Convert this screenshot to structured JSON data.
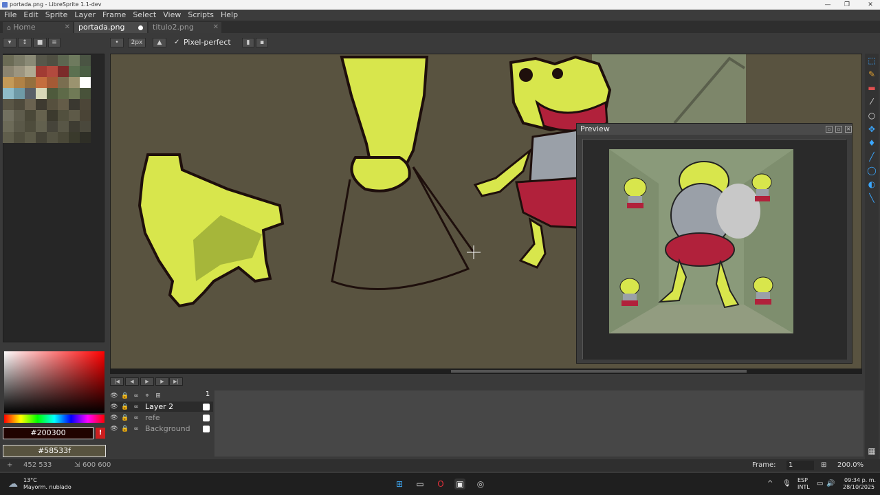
{
  "window": {
    "title": "portada.png - LibreSprite 1.1-dev"
  },
  "menu": [
    "File",
    "Edit",
    "Sprite",
    "Layer",
    "Frame",
    "Select",
    "View",
    "Scripts",
    "Help"
  ],
  "tabs": [
    {
      "label": "Home",
      "icon": "home-icon"
    },
    {
      "label": "portada.png"
    },
    {
      "label": "titulo2.png"
    }
  ],
  "tool_options": {
    "brush_size": "2px",
    "pixel_perfect_label": "Pixel-perfect",
    "pixel_perfect": true
  },
  "palette": [
    "#6b6b55",
    "#7a7a66",
    "#8a8a76",
    "#57574a",
    "#4f4f42",
    "#5c6650",
    "#6e7a5e",
    "#4a5443",
    "#8b8470",
    "#9c9580",
    "#b0aa92",
    "#a13b33",
    "#b24a3e",
    "#7b2b2a",
    "#5b7050",
    "#4a5e44",
    "#c49a58",
    "#b08246",
    "#95703e",
    "#c46e3e",
    "#a45a35",
    "#7a6e50",
    "#9b936f",
    "#ffffff",
    "#8fbcc8",
    "#6f9aa6",
    "#5a6068",
    "#d8d8b8",
    "#4e5a3c",
    "#5e6a48",
    "#707a56",
    "#48523a",
    "#5a5646",
    "#4e4a3c",
    "#6a6250",
    "#3e3a30",
    "#56503e",
    "#645c48",
    "#3a3830",
    "#4c4638",
    "#727060",
    "#5e5c4c",
    "#4a4838",
    "#66624e",
    "#3c3a2e",
    "#52503e",
    "#5e5a48",
    "#4a4436",
    "#6c6a58",
    "#5a5848",
    "#4e4c3c",
    "#62604e",
    "#46443a",
    "#585646",
    "#3e3c32",
    "#4a483c",
    "#605e4c",
    "#504e3e",
    "#5c5a48",
    "#444236",
    "#545242",
    "#4a4838",
    "#3a3a2c",
    "#2e2e26"
  ],
  "colors": {
    "foreground": "#200300",
    "background": "#58533f"
  },
  "preview": {
    "title": "Preview"
  },
  "layers": [
    {
      "name": "Layer 2",
      "active": true
    },
    {
      "name": "refe",
      "active": false
    },
    {
      "name": "Background",
      "active": false
    }
  ],
  "timeline": {
    "frame_header": "1"
  },
  "status": {
    "cursor": "452 533",
    "size": "600 600",
    "frame_label": "Frame:",
    "frame_value": "1",
    "zoom": "200.0%"
  },
  "taskbar": {
    "weather_temp": "13°C",
    "weather_desc": "Mayorm. nublado",
    "lang": "ESP",
    "lang2": "INTL",
    "time": "09:34 p. m.",
    "date": "28/10/2025"
  }
}
